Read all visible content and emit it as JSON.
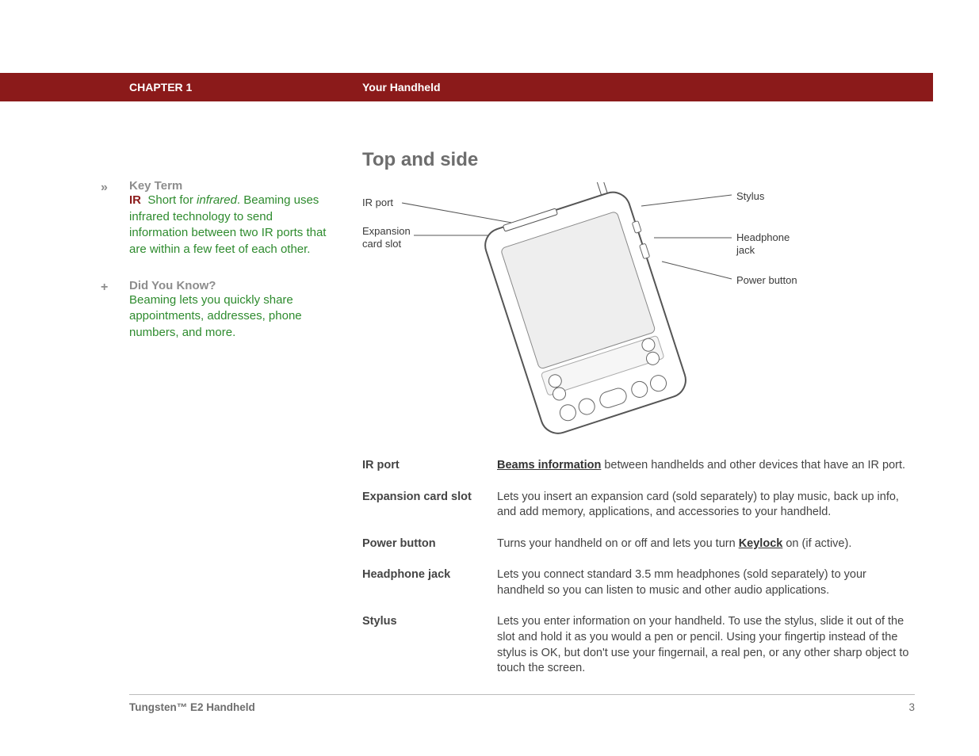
{
  "header": {
    "chapter": "CHAPTER 1",
    "title": "Your Handheld"
  },
  "sidebar": {
    "keyterm": {
      "icon": "»",
      "heading": "Key Term",
      "keyword": "IR",
      "lead": "Short for ",
      "ital": "infrared",
      "tail": ". Beaming uses infrared technology to send information between two IR ports that are within a few feet of each other."
    },
    "didyou": {
      "icon": "+",
      "heading": "Did You Know?",
      "body": "Beaming lets you quickly share appointments, addresses, phone numbers, and more."
    }
  },
  "main": {
    "section_title": "Top and side",
    "labels": {
      "ir_port": "IR port",
      "expansion1": "Expansion",
      "expansion2": "card slot",
      "stylus": "Stylus",
      "headphone1": "Headphone",
      "headphone2": "jack",
      "power": "Power button"
    },
    "defs": [
      {
        "term": "IR port",
        "link": "Beams information",
        "rest": " between handhelds and other devices that have an IR port."
      },
      {
        "term": "Expansion card slot",
        "desc": "Lets you insert an expansion card (sold separately) to play music, back up info, and add memory, applications, and accessories to your handheld."
      },
      {
        "term": "Power button",
        "pre": "Turns your handheld on or off and lets you turn ",
        "link": "Keylock",
        "post": " on (if active)."
      },
      {
        "term": "Headphone jack",
        "desc": "Lets you connect standard 3.5 mm headphones (sold separately) to your handheld so you can listen to music and other audio applications."
      },
      {
        "term": "Stylus",
        "desc": "Lets you enter information on your handheld. To use the stylus, slide it out of the slot and hold it as you would a pen or pencil. Using your fingertip instead of the stylus is OK, but don't use your fingernail, a real pen, or any other sharp object to touch the screen."
      }
    ]
  },
  "footer": {
    "product_bold": "Tungsten™ E2",
    "product_light": " Handheld",
    "page": "3"
  }
}
